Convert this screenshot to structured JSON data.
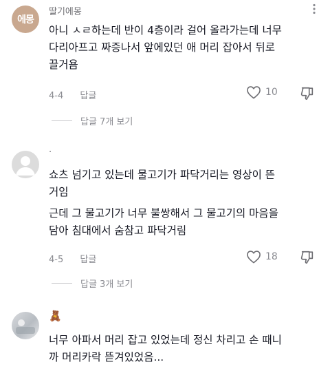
{
  "comments": [
    {
      "avatar_text": "에몽",
      "username": "딸기에몽",
      "lines": [
        "아니 ㅅㄹ하는데 반이 4층이라 걸어 올라가는데 너무",
        "다리아프고 짜증나서 앞에있던 애 머리 잡아서 뒤로",
        "끌거욤"
      ],
      "date": "4-4",
      "reply_label": "답글",
      "likes": "10",
      "view_replies": "답글 7개 보기"
    },
    {
      "username": ".",
      "lines": [
        "쇼츠 넘기고 있는데 물고기가 파닥거리는 영상이 뜬",
        "거임",
        "근데 그 물고기가 너무 불쌍해서 그 물고기의 마음을",
        "담아 침대에서 숨참고 파닥거림"
      ],
      "date": "4-5",
      "reply_label": "답글",
      "likes": "18",
      "view_replies": "답글 3개 보기"
    },
    {
      "username": "🧸",
      "lines": [
        "너무 아파서 머리 잡고 있었는데 정신 차리고 손 때니",
        "까 머리카락 뜯겨있었음..."
      ]
    }
  ],
  "icons": {
    "more": "more-vertical-icon",
    "like": "heart-outline-icon",
    "dislike": "thumbs-down-icon"
  }
}
